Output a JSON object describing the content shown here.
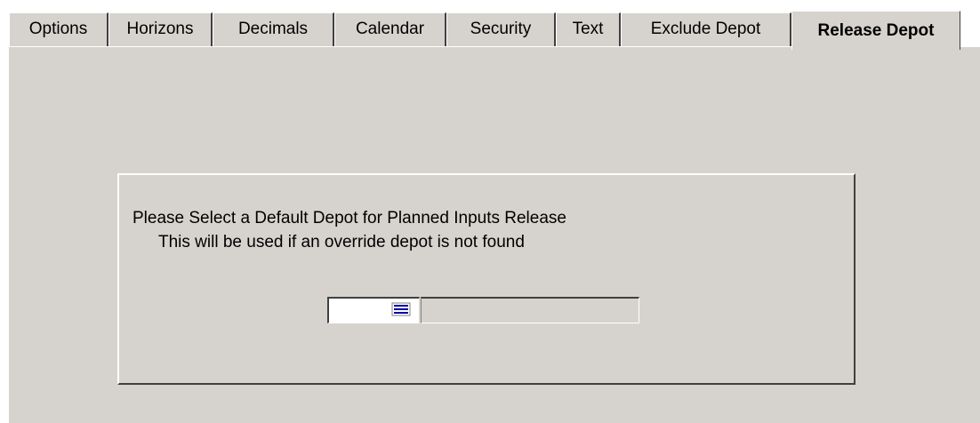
{
  "tabs": [
    {
      "label": "Options"
    },
    {
      "label": "Horizons"
    },
    {
      "label": "Decimals"
    },
    {
      "label": "Calendar"
    },
    {
      "label": "Security"
    },
    {
      "label": "Text"
    },
    {
      "label": "Exclude Depot"
    },
    {
      "label": "Release Depot",
      "selected": true
    }
  ],
  "release_depot": {
    "instruction_line1": "Please Select a Default Depot for Planned Inputs Release",
    "instruction_line2": "This will be used if an override depot is not found",
    "depot_code": "",
    "depot_description": "",
    "lookup_icon": "list-lookup-icon"
  },
  "colors": {
    "face": "#d6d3ce",
    "highlight": "#ffffff",
    "shadow": "#404040",
    "icon_blue": "#0000a0"
  }
}
